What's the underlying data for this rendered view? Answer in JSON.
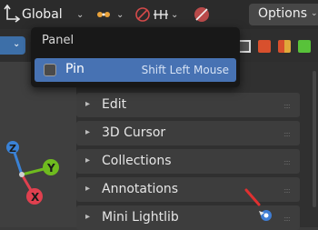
{
  "header": {
    "transform_orientation": "Global",
    "options_label": "Options"
  },
  "popup": {
    "title": "Panel",
    "item_label": "Pin",
    "item_shortcut": "Shift Left Mouse",
    "item_checked": false
  },
  "gizmo": {
    "x_label": "X",
    "y_label": "Y",
    "z_label": "Z"
  },
  "sidebar": {
    "panels": [
      {
        "label": "Edit"
      },
      {
        "label": "3D Cursor"
      },
      {
        "label": "Collections"
      },
      {
        "label": "Annotations"
      },
      {
        "label": "Mini Lightlib"
      }
    ]
  },
  "colors": {
    "accent": "#4772b3",
    "x_axis": "#e0404f",
    "y_axis": "#6fbb1f",
    "z_axis": "#3a82d6"
  }
}
